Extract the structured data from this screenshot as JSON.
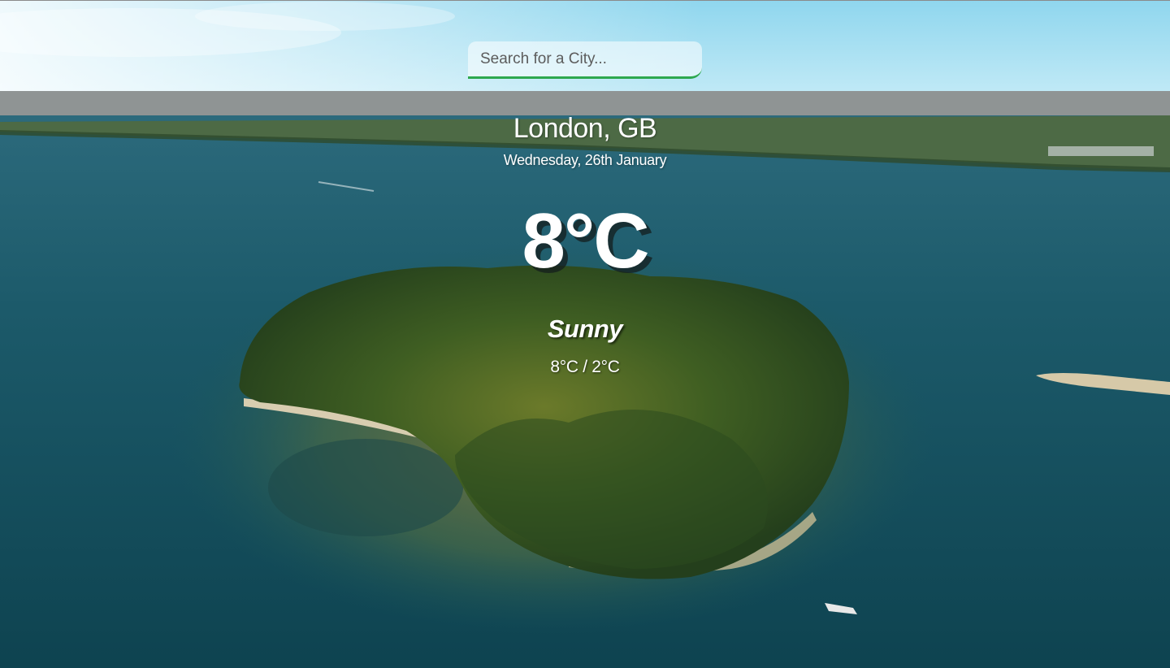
{
  "search": {
    "placeholder": "Search for a City...",
    "value": "",
    "accent_color": "#2ea84f"
  },
  "weather": {
    "location": "London, GB",
    "date": "Wednesday, 26th January",
    "temperature": "8°C",
    "condition": "Sunny",
    "hi_lo": "8°C / 2°C"
  },
  "background": {
    "description_icon": "island-landscape-image"
  }
}
